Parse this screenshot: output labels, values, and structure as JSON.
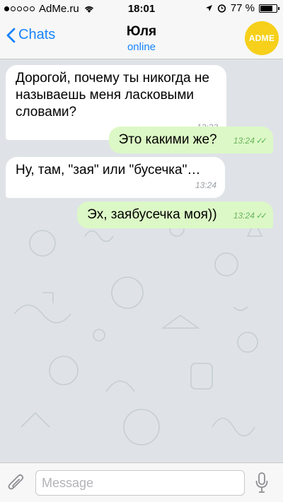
{
  "status_bar": {
    "carrier": "AdMe.ru",
    "time": "18:01",
    "battery": "77 %",
    "battery_level": 0.77
  },
  "nav": {
    "back_label": "Chats",
    "title": "Юля",
    "subtitle": "online",
    "avatar_text": "ADME"
  },
  "messages": [
    {
      "direction": "in",
      "text": "Дорогой, почему ты никогда не называешь меня ласковыми словами?",
      "time": "13:23"
    },
    {
      "direction": "out",
      "text": "Это какими же?",
      "time": "13:24",
      "read": true
    },
    {
      "direction": "in",
      "text": "Ну, там, \"зая\" или \"бусечка\"…",
      "time": "13:24"
    },
    {
      "direction": "out",
      "text": "Эх, заябусечка моя))",
      "time": "13:24",
      "read": true
    }
  ],
  "input": {
    "placeholder": "Message"
  },
  "colors": {
    "accent": "#1683fb",
    "outgoing_bubble": "#dcf8c6",
    "incoming_bubble": "#ffffff",
    "avatar": "#f6d01a"
  }
}
